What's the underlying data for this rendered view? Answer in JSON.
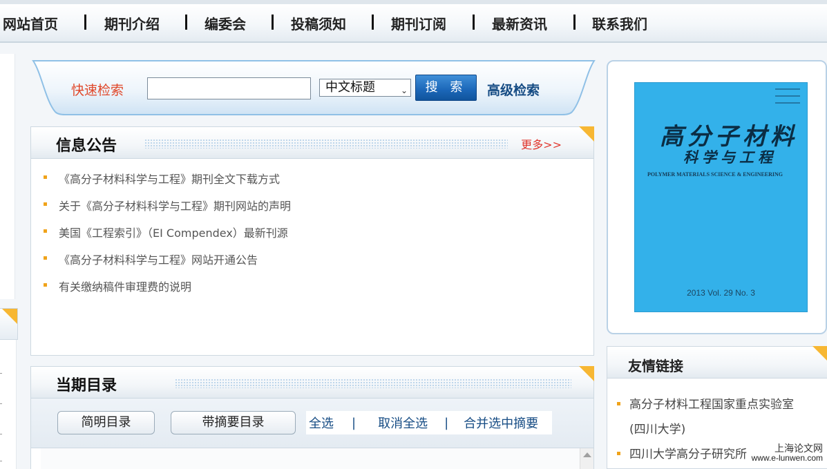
{
  "nav": {
    "items": [
      {
        "label": "网站首页"
      },
      {
        "label": "期刊介绍"
      },
      {
        "label": "编委会"
      },
      {
        "label": "投稿须知"
      },
      {
        "label": "期刊订阅"
      },
      {
        "label": "最新资讯"
      },
      {
        "label": "联系我们"
      }
    ]
  },
  "search": {
    "label": "快速检索",
    "input_value": "",
    "select_value": "中文标题",
    "button_label": "搜 索",
    "advanced_label": "高级检索"
  },
  "notices": {
    "title": "信息公告",
    "more_label": "更多>>",
    "items": [
      "《高分子材料科学与工程》期刊全文下载方式",
      "关于《高分子材料科学与工程》期刊网站的声明",
      "美国《工程索引》（EI Compendex）最新刊源",
      "《高分子材料科学与工程》网站开通公告",
      "有关缴纳稿件审理费的说明"
    ]
  },
  "toc": {
    "title": "当期目录",
    "brief_button": "简明目录",
    "abstract_button": "带摘要目录",
    "select_all": "全选",
    "deselect_all": "取消全选",
    "merge_abstracts": "合并选中摘要",
    "separator": "|"
  },
  "cover": {
    "title_cn": "高分子材料",
    "subtitle_cn": "科学与工程",
    "title_en": "POLYMER MATERIALS SCIENCE & ENGINEERING",
    "issue": "2013 Vol. 29 No. 3"
  },
  "links": {
    "title": "友情链接",
    "items": [
      "高分子材料工程国家重点实验室(四川大学)",
      "四川大学高分子研究所"
    ]
  },
  "watermark": {
    "line1": "上海论文网",
    "line2": "www.e-lunwen.com"
  },
  "colors": {
    "accent_orange": "#f7b733",
    "link_blue": "#164c84",
    "search_label_red": "#e0482a",
    "cover_blue": "#33b1ea"
  }
}
